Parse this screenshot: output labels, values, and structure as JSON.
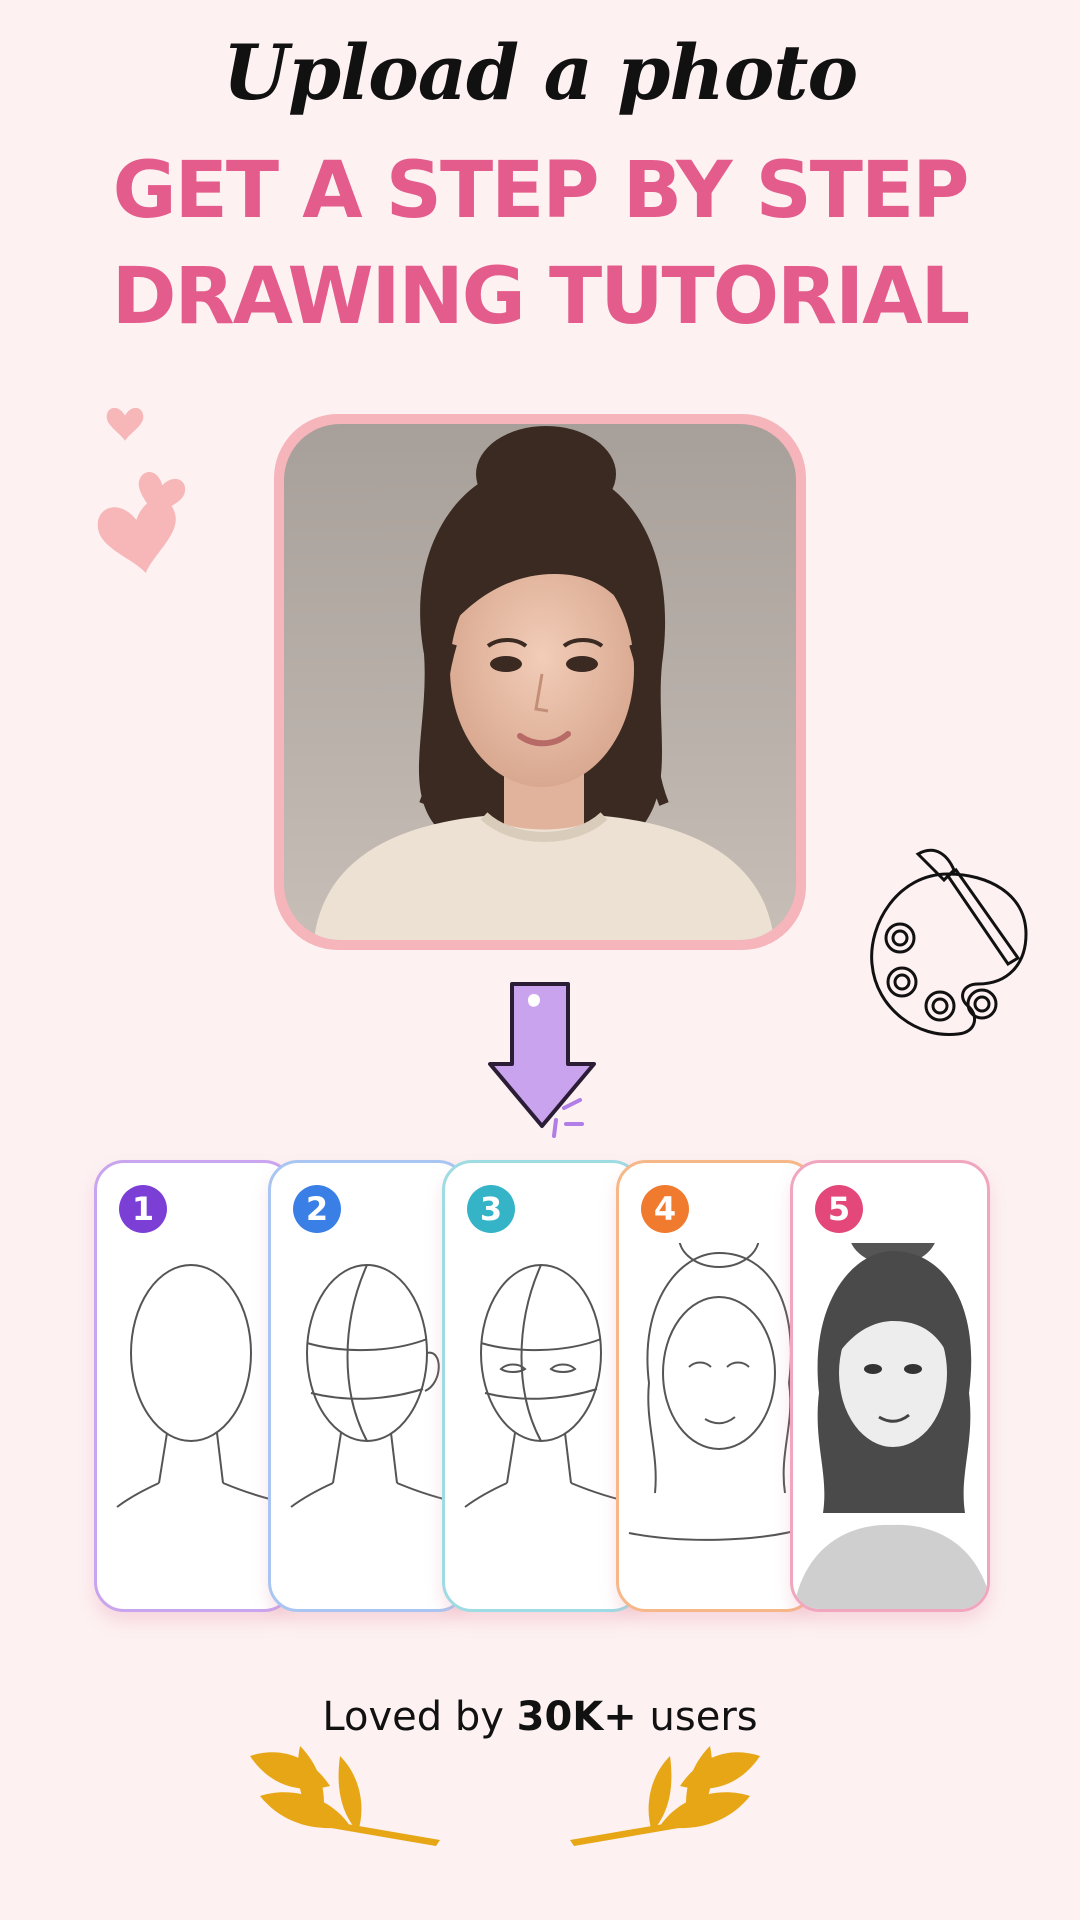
{
  "header": {
    "subtitle": "Upload a photo",
    "title_line1": "GET A STEP BY STEP",
    "title_line2": "DRAWING TUTORIAL"
  },
  "photo": {
    "description_icon": "portrait-photo"
  },
  "steps": [
    {
      "number": "1",
      "color": "#7c3fd6",
      "border": "#c9a4ef"
    },
    {
      "number": "2",
      "color": "#3a7fe6",
      "border": "#a9c6f2"
    },
    {
      "number": "3",
      "color": "#35b3c7",
      "border": "#9fdbe3"
    },
    {
      "number": "4",
      "color": "#f07a2e",
      "border": "#f6b888"
    },
    {
      "number": "5",
      "color": "#e4487a",
      "border": "#f1a6bf"
    }
  ],
  "footer": {
    "loved_prefix": "Loved by ",
    "loved_count": "30K+",
    "loved_suffix": " users"
  },
  "colors": {
    "accent": "#e45c8c",
    "background": "#fdf1f2",
    "frame": "#f5b5bb",
    "arrow": "#caa3ee",
    "laurel": "#e6a615"
  }
}
